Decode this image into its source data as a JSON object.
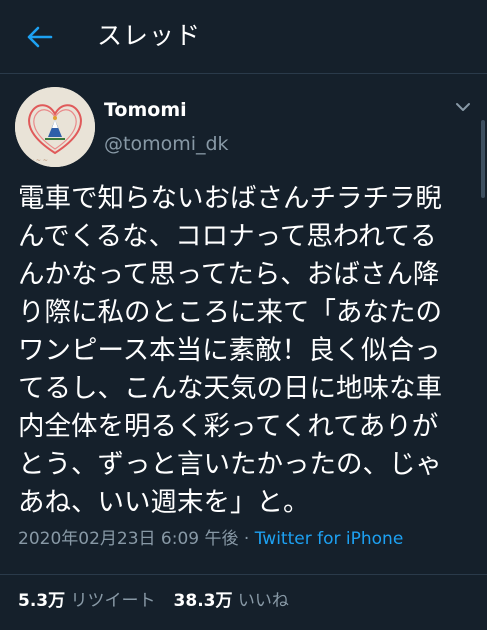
{
  "header": {
    "title": "スレッド",
    "back_icon": "arrow-left-icon",
    "accent_color": "#1da1f2"
  },
  "author": {
    "name": "Tomomi",
    "handle": "@tomomi_dk",
    "menu_icon": "chevron-down-icon"
  },
  "tweet": {
    "lines": [
      "電車で知らないおばさんチラチラ睨",
      "んでくるな、コロナって思われてる",
      "んかなって思ってたら、おばさん降",
      "り際に私のところに来て「あなたの",
      "ワンピース本当に素敵！良く似合っ",
      "てるし、こんな天気の日に地味な車",
      "内全体を明るく彩ってくれてありが",
      "とう、ずっと言いたかったの、じゃ",
      "あね、いい週末を」と。"
    ],
    "timestamp": "2020年02月23日 6:09 午後 · ",
    "source": "Twitter for iPhone"
  },
  "stats": {
    "retweets_count": "5.3万",
    "retweets_label": "リツイート",
    "likes_count": "38.3万",
    "likes_label": "いいね"
  },
  "colors": {
    "background": "#15202b",
    "secondary_text": "#8899a6",
    "link": "#1da1f2"
  }
}
